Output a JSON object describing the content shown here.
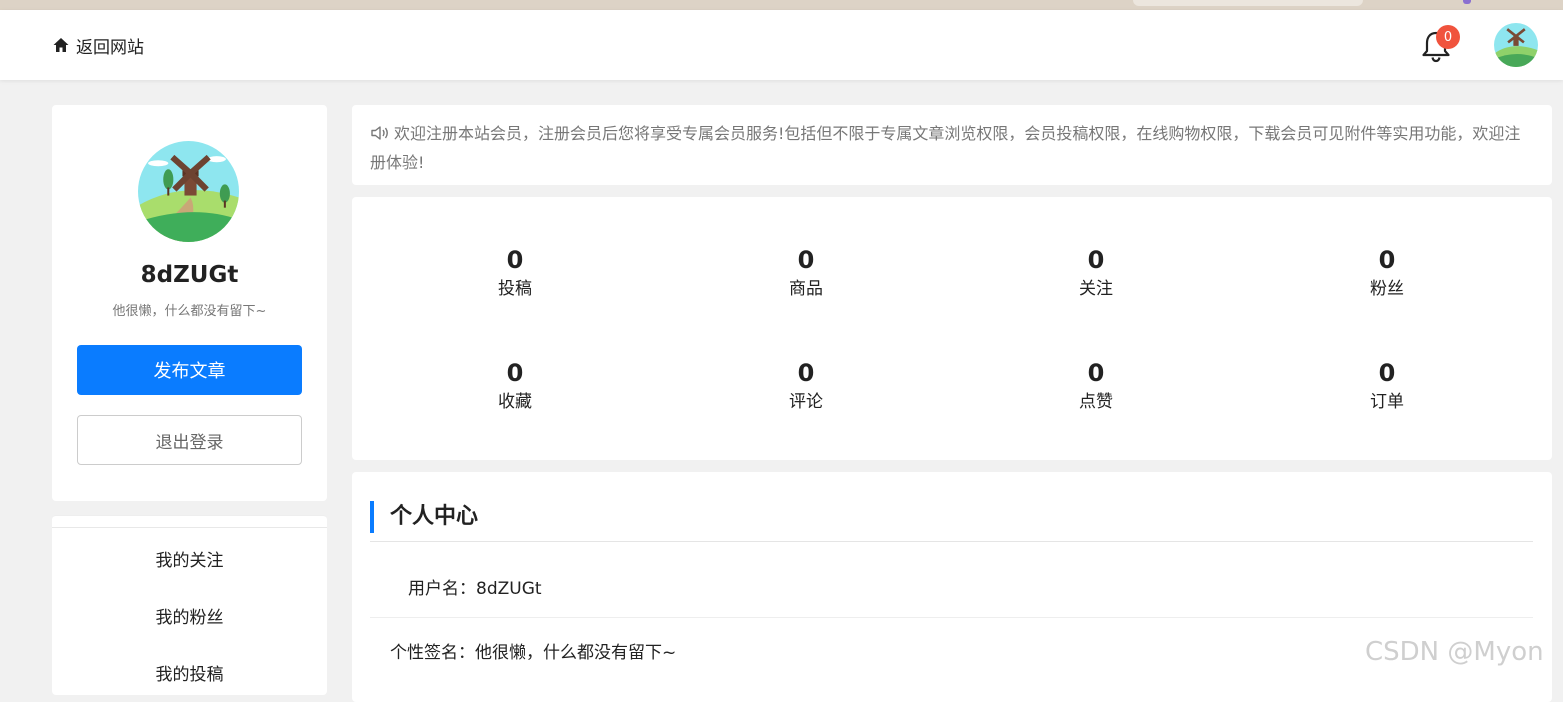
{
  "header": {
    "back_label": "返回网站",
    "notification_count": "0"
  },
  "profile": {
    "username": "8dZUGt",
    "signature": "他很懒，什么都没有留下~",
    "publish_button": "发布文章",
    "logout_button": "退出登录"
  },
  "menu": {
    "items": [
      {
        "label": "我的关注"
      },
      {
        "label": "我的粉丝"
      },
      {
        "label": "我的投稿"
      }
    ]
  },
  "notice": {
    "text": "欢迎注册本站会员，注册会员后您将享受专属会员服务!包括但不限于专属文章浏览权限，会员投稿权限，在线购物权限，下载会员可见附件等实用功能，欢迎注册体验!"
  },
  "stats": [
    {
      "value": "0",
      "label": "投稿"
    },
    {
      "value": "0",
      "label": "商品"
    },
    {
      "value": "0",
      "label": "关注"
    },
    {
      "value": "0",
      "label": "粉丝"
    },
    {
      "value": "0",
      "label": "收藏"
    },
    {
      "value": "0",
      "label": "评论"
    },
    {
      "value": "0",
      "label": "点赞"
    },
    {
      "value": "0",
      "label": "订单"
    }
  ],
  "personal_center": {
    "title": "个人中心",
    "username_label": "用户名：",
    "username_value": "8dZUGt",
    "signature_label": "个性签名：",
    "signature_value": "他很懒，什么都没有留下~"
  },
  "watermark": "CSDN @Myon",
  "colors": {
    "accent": "#0a7cff",
    "badge": "#f0533d",
    "background": "#f1f1f1"
  }
}
